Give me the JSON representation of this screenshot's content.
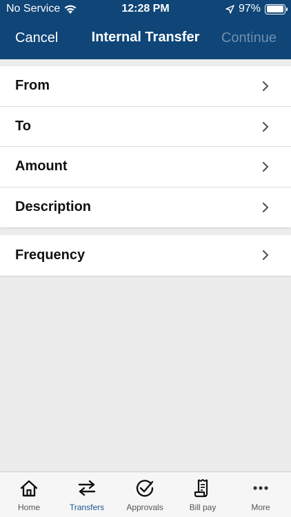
{
  "status_bar": {
    "carrier": "No Service",
    "time": "12:28 PM",
    "battery": "97%",
    "battery_level": 0.97,
    "icons": [
      "wifi-icon",
      "location-arrow-icon",
      "battery-icon"
    ]
  },
  "nav": {
    "cancel_label": "Cancel",
    "title": "Internal Transfer",
    "continue_label": "Continue"
  },
  "form": {
    "group1": [
      {
        "label": "From"
      },
      {
        "label": "To"
      },
      {
        "label": "Amount"
      },
      {
        "label": "Description"
      }
    ],
    "group2": [
      {
        "label": "Frequency"
      }
    ]
  },
  "tab_bar": {
    "tabs": [
      {
        "label": "Home",
        "icon": "home-icon"
      },
      {
        "label": "Transfers",
        "icon": "transfer-arrows-icon",
        "active": true
      },
      {
        "label": "Approvals",
        "icon": "check-circle-icon"
      },
      {
        "label": "Bill pay",
        "icon": "receipt-icon"
      },
      {
        "label": "More",
        "icon": "more-dots-icon"
      }
    ]
  },
  "colors": {
    "header_bg": "#0f4577",
    "continue_disabled": "#6f8fae",
    "tab_active": "#1a5590",
    "background": "#ececec"
  }
}
